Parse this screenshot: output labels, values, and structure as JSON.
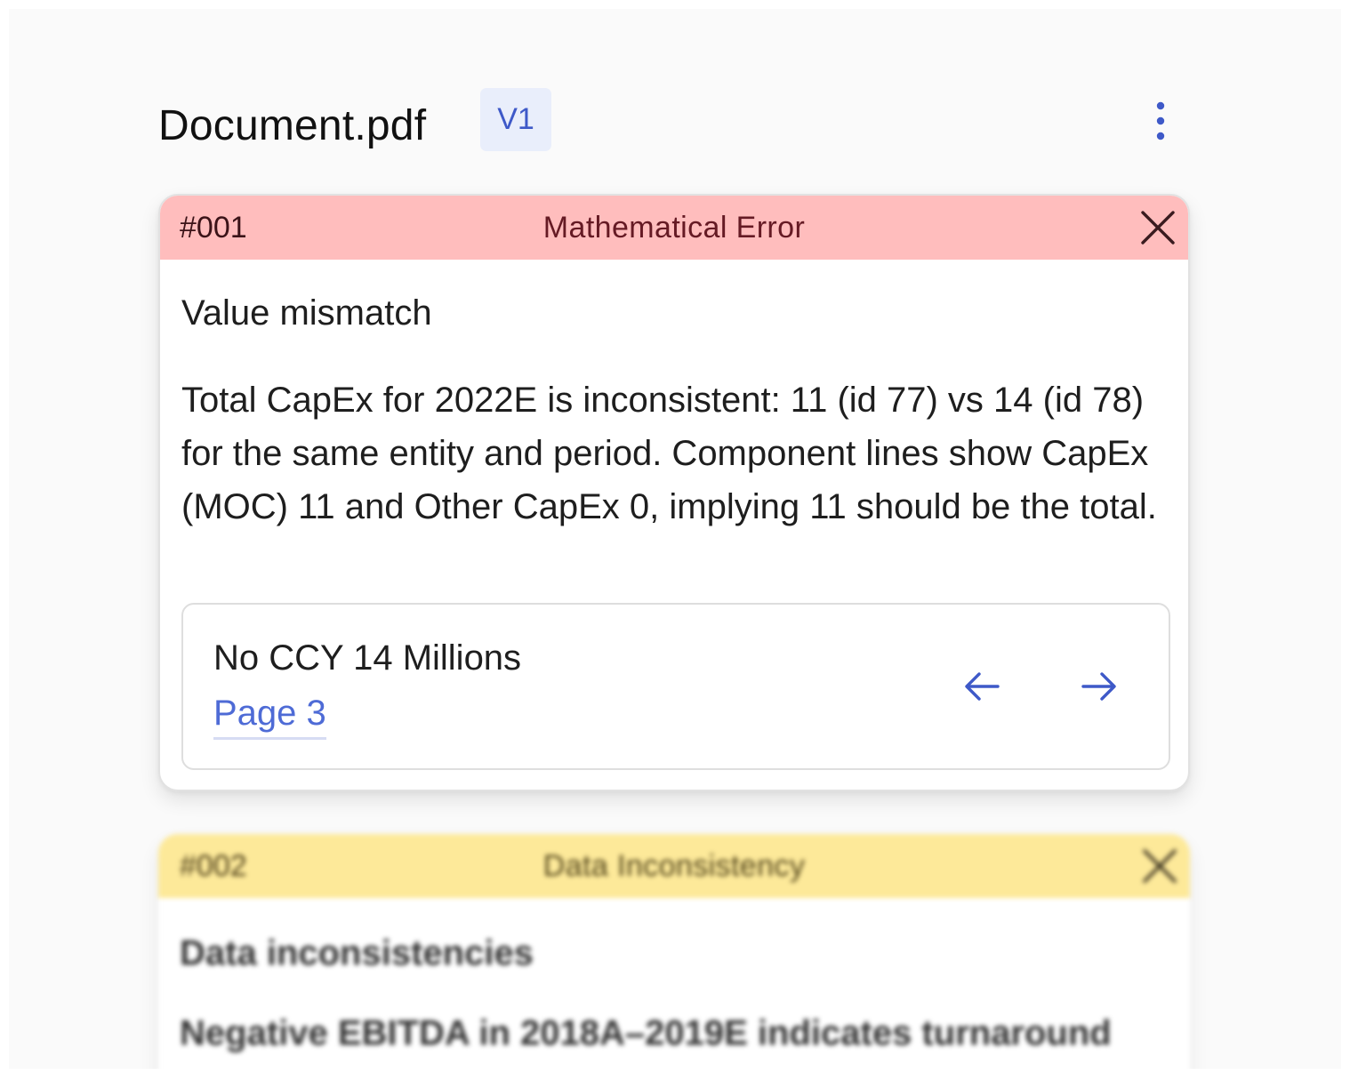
{
  "header": {
    "document_name": "Document.pdf",
    "version_label": "V1",
    "menu_icon": "more-vertical-icon"
  },
  "issues": [
    {
      "id": "#001",
      "category": "Mathematical Error",
      "category_color": "#ffbdbd",
      "title": "Value mismatch",
      "description": "Total CapEx for 2022E is inconsistent: 11 (id 77) vs 14 (id 78) for the same entity and period. Component lines show CapEx (MOC) 11 and Other CapEx 0, implying 11 should be the total.",
      "reference": {
        "label": "No CCY 14 Millions",
        "page_link": "Page 3"
      }
    },
    {
      "id": "#002",
      "category": "Data Inconsistency",
      "category_color": "#fde999",
      "title": "Data inconsistencies",
      "description": "Negative EBITDA in 2018A–2019E indicates turnaround"
    }
  ],
  "colors": {
    "accent": "#4e6bd6",
    "badge_bg": "#e9eefb"
  }
}
